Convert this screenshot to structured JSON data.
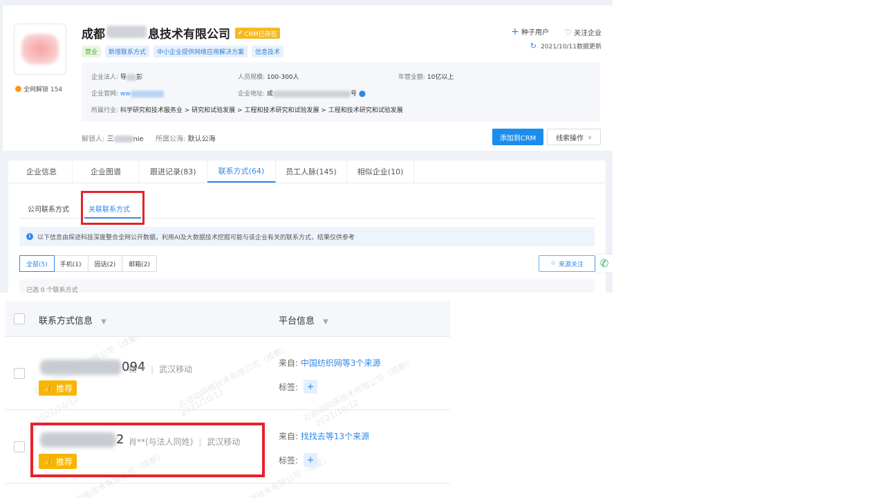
{
  "company": {
    "name_prefix": "成都",
    "name_suffix": "息技术有限公司",
    "crm_badge": "CRM已存在",
    "unlock_label": "全网解锁 154",
    "tags": [
      "营业",
      "新增联系方式",
      "中小企业提供网络应用解决方案",
      "信息技术"
    ]
  },
  "actions": {
    "seed_user": "种子用户",
    "follow_company": "关注企业",
    "updated": "2021/10/11数据更新"
  },
  "info": {
    "legal_rep_label": "企业法人:",
    "legal_rep_a": "导",
    "legal_rep_b": "彭",
    "staff_label": "人员规模:",
    "staff_value": "100-300人",
    "revenue_label": "年营业额:",
    "revenue_value": "10亿以上",
    "website_label": "企业官网:",
    "website_value": "ww",
    "address_label": "企业地址:",
    "address_a": "成",
    "address_b": "号",
    "industry_label": "所属行业:",
    "industry_value": "科学研究和技术服务业 > 研究和试验发展 > 工程和技术研究和试验发展 > 工程和技术研究和试验发展"
  },
  "contact_line": {
    "unlocker_label": "解锁人:",
    "unlocker_a": "三",
    "unlocker_b": "nie",
    "pool_label": "所属公海:",
    "pool_value": "默认公海"
  },
  "buttons": {
    "add_crm": "添加到CRM",
    "clue_ops": "线索操作"
  },
  "main_tabs": [
    "企业信息",
    "企业图谱",
    "跟进记录(83)",
    "联系方式(64)",
    "员工人脉(145)",
    "相似企业(10)"
  ],
  "active_main_tab": "联系方式(64)",
  "sub_tabs": [
    "公司联系方式",
    "关联联系方式"
  ],
  "notice": "以下信息由探迹科技深度整合全网公开数据，利用AI及大数据技术挖掘可能与该企业有关的联系方式，结果仅供参考",
  "filters": [
    "全部(5)",
    "手机(1)",
    "固话(2)",
    "邮箱(2)"
  ],
  "source_follow": "来源关注",
  "selected_text": "已选 0 个联系方式",
  "table": {
    "col_contact": "联系方式信息",
    "col_platform": "平台信息",
    "rows": [
      {
        "phone_tail": "094",
        "person": "杨**",
        "carrier": "武汉移动",
        "badge": "推荐",
        "from_label": "来自:",
        "source": "中国纺织网等3个来源",
        "tag_label": "标签:"
      },
      {
        "phone_tail": "2",
        "person": "肖**(与法人同姓)",
        "carrier": "武汉移动",
        "badge": "推荐",
        "from_label": "来自:",
        "source": "找找去等13个来源",
        "tag_label": "标签:"
      }
    ]
  },
  "watermarks": [
    "云迹动网络技术有限公司（成都）",
    "2021/10/12"
  ],
  "colors": {
    "accent": "#2e87ea",
    "highlight": "#e62129",
    "badge": "#f7b500",
    "crm": "#f5b923"
  }
}
